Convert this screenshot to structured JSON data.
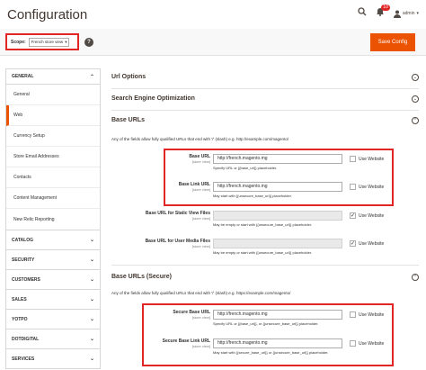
{
  "header": {
    "title": "Configuration",
    "notification_count": "10",
    "user": "admin"
  },
  "icons": {
    "search": "search-icon",
    "bell": "bell-icon",
    "user": "user-icon"
  },
  "scope": {
    "label": "Scope:",
    "value": "French store view"
  },
  "save_label": "Save Config",
  "colors": {
    "accent": "#eb5202",
    "highlight": "#e22626"
  },
  "sidebar": {
    "general": "GENERAL",
    "items": [
      {
        "label": "General",
        "active": false
      },
      {
        "label": "Web",
        "active": true
      },
      {
        "label": "Currency Setup",
        "active": false
      },
      {
        "label": "Store Email Addresses",
        "active": false
      },
      {
        "label": "Contacts",
        "active": false
      },
      {
        "label": "Content Management",
        "active": false
      },
      {
        "label": "New Relic Reporting",
        "active": false
      }
    ],
    "groups": [
      "CATALOG",
      "SECURITY",
      "CUSTOMERS",
      "SALES",
      "YOTPO",
      "DOTDIGITAL",
      "SERVICES"
    ]
  },
  "sections": {
    "url_options": "Url Options",
    "seo": "Search Engine Optimization",
    "base_urls": "Base URLs",
    "base_urls_secure": "Base URLs (Secure)"
  },
  "base_urls": {
    "intro": "Any of the fields allow fully qualified URLs that end with '/' (slash) e.g. http://example.com/magento/",
    "rows": [
      {
        "label": "Base URL",
        "scope": "[store view]",
        "value": "http://french.magento.mg",
        "note": "Specify URL or {{base_url}} placeholder.",
        "use_website": "Use Website",
        "checked": false
      },
      {
        "label": "Base Link URL",
        "scope": "[store view]",
        "value": "http://french.magento.mg",
        "note": "May start with {{unsecure_base_url}} placeholder.",
        "use_website": "Use Website",
        "checked": false
      },
      {
        "label": "Base URL for Static View Files",
        "scope": "[store view]",
        "value": "",
        "note": "May be empty or start with {{unsecure_base_url}} placeholder.",
        "use_website": "Use Website",
        "checked": true
      },
      {
        "label": "Base URL for User Media Files",
        "scope": "[store view]",
        "value": "",
        "note": "May be empty or start with {{unsecure_base_url}} placeholder.",
        "use_website": "Use Website",
        "checked": true
      }
    ]
  },
  "base_urls_secure": {
    "intro": "Any of the fields allow fully qualified URLs that end with '/' (slash) e.g. https://example.com/magento/",
    "rows": [
      {
        "label": "Secure Base URL",
        "scope": "[store view]",
        "value": "http://french.magento.mg",
        "note": "Specify URL or {{base_url}}, or {{unsecure_base_url}} placeholder.",
        "use_website": "Use Website",
        "checked": false
      },
      {
        "label": "Secure Base Link URL",
        "scope": "[store view]",
        "value": "http://french.magento.mg",
        "note": "May start with {{secure_base_url}} or {{unsecure_base_url}} placeholder.",
        "use_website": "Use Website",
        "checked": false
      }
    ]
  }
}
